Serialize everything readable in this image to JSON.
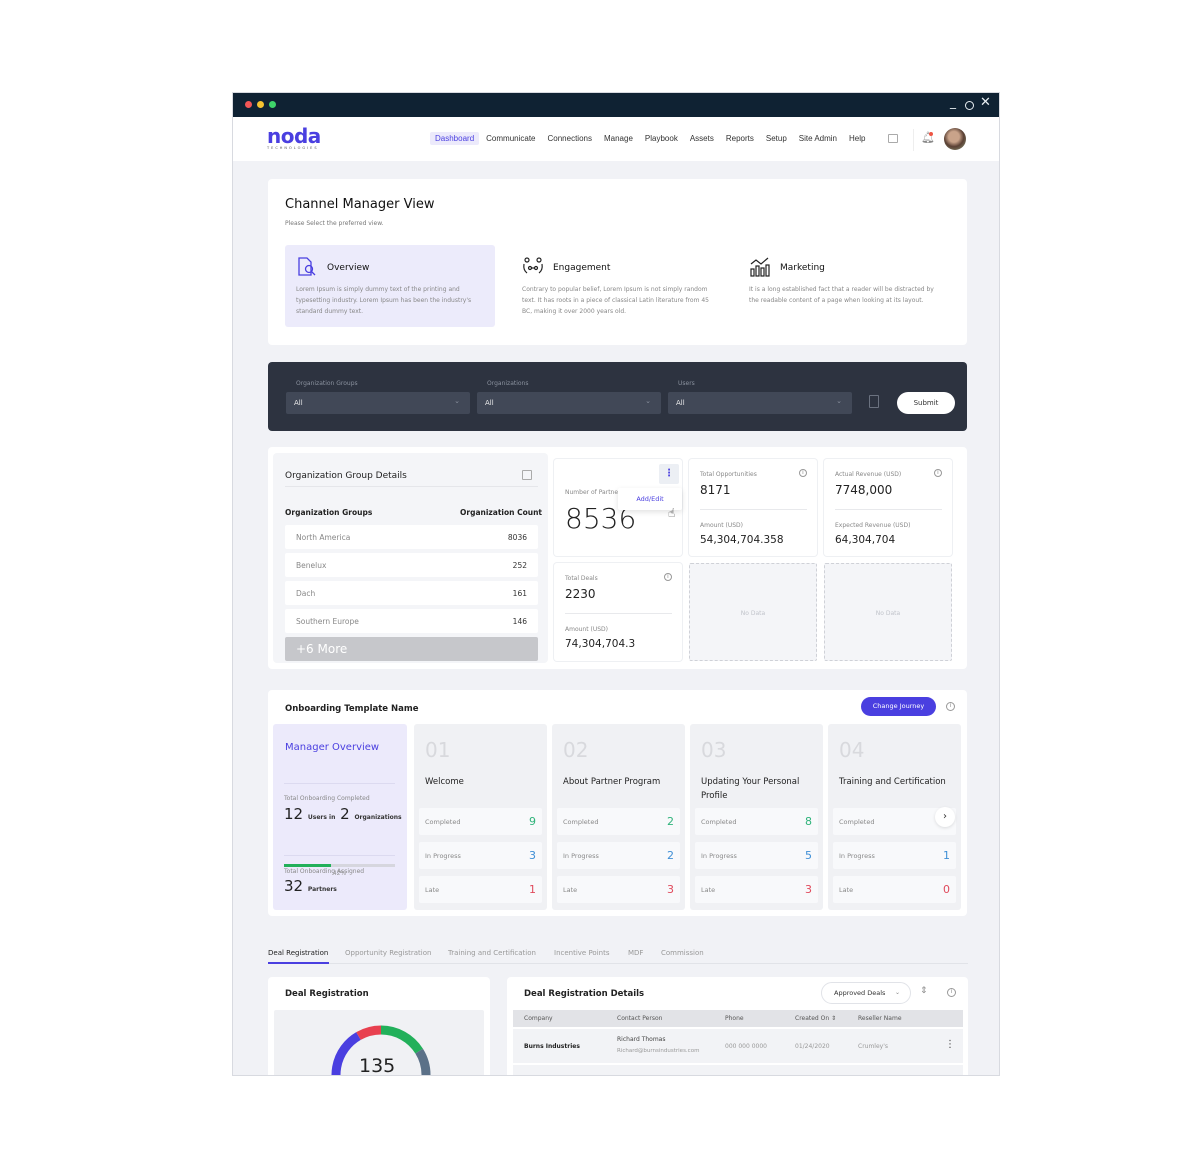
{
  "window": {
    "controls": {
      "minimize": "_",
      "close": "✕"
    }
  },
  "navbar": {
    "logo_text": "noda",
    "logo_subtext": "TECHNOLOGIES",
    "links": [
      "Dashboard",
      "Communicate",
      "Connections",
      "Manage",
      "Playbook",
      "Assets",
      "Reports",
      "Setup",
      "Site Admin",
      "Help"
    ],
    "active_link": "Dashboard",
    "icons": [
      "list-icon",
      "bell-icon",
      "avatar"
    ]
  },
  "channel_manager": {
    "title": "Channel Manager View",
    "subtitle": "Please Select the preferred view.",
    "views": [
      {
        "icon": "document-search-icon",
        "title": "Overview",
        "description": "Lorem Ipsum is simply dummy text of the printing and typesetting industry. Lorem Ipsum has been the industry's standard dummy text.",
        "selected": true
      },
      {
        "icon": "people-connect-icon",
        "title": "Engagement",
        "description": "Contrary to popular belief, Lorem Ipsum is not simply random text. It has roots in a piece of classical Latin literature from 45 BC, making it over 2000 years old.",
        "selected": false
      },
      {
        "icon": "chart-growth-icon",
        "title": "Marketing",
        "description": "It is a long established fact that a reader will be distracted by the readable content of a page when looking at its layout.",
        "selected": false
      }
    ]
  },
  "filters": {
    "fields": [
      {
        "label": "Organization Groups",
        "value": "All"
      },
      {
        "label": "Organizations",
        "value": "All"
      },
      {
        "label": "Users",
        "value": "All"
      }
    ],
    "submit_label": "Submit"
  },
  "org_group_details": {
    "title": "Organization Group Details",
    "col_groups": "Organization Groups",
    "col_count": "Organization Count",
    "rows": [
      {
        "name": "North America",
        "count": "8036"
      },
      {
        "name": "Benelux",
        "count": "252"
      },
      {
        "name": "Dach",
        "count": "161"
      },
      {
        "name": "Southern Europe",
        "count": "146"
      }
    ],
    "more_label": "+6 More"
  },
  "stats": {
    "partners": {
      "label": "Number of Partners",
      "value": "8536",
      "menu_item": "Add/Edit"
    },
    "opportunities": {
      "label": "Total Opportunities",
      "value": "8171",
      "sub_label": "Amount (USD)",
      "sub_value": "54,304,704.358"
    },
    "revenue": {
      "label": "Actual Revenue (USD)",
      "value": "7748,000",
      "sub_label": "Expected Revenue (USD)",
      "sub_value": "64,304,704"
    },
    "deals": {
      "label": "Total Deals",
      "value": "2230",
      "sub_label": "Amount (USD)",
      "sub_value": "74,304,704.3"
    },
    "no_data_label": "No Data"
  },
  "onboarding": {
    "title": "Onboarding Template Name",
    "change_journey_label": "Change Journey",
    "manager": {
      "title": "Manager Overview",
      "completed_label": "Total Onboarding Completed",
      "users": "12",
      "users_text": "Users in",
      "orgs": "2",
      "orgs_text": "Organizations",
      "progress_percent": 42,
      "progress_label": "42%",
      "assigned_label": "Total Onboarding Assigned",
      "assigned": "32",
      "assigned_text": "Partners"
    },
    "steps": [
      {
        "num": "01",
        "title": "Welcome",
        "completed": "9",
        "in_progress": "3",
        "late": "1"
      },
      {
        "num": "02",
        "title": "About Partner Program",
        "completed": "2",
        "in_progress": "2",
        "late": "3"
      },
      {
        "num": "03",
        "title": "Updating Your Personal Profile",
        "completed": "8",
        "in_progress": "5",
        "late": "3"
      },
      {
        "num": "04",
        "title": "Training and Certification",
        "completed": "",
        "in_progress": "1",
        "late": "0"
      }
    ],
    "row_labels": {
      "completed": "Completed",
      "in_progress": "In Progress",
      "late": "Late"
    },
    "colors": {
      "completed": "#2fb37a",
      "in_progress": "#3f8fd6",
      "late": "#e04a5c"
    }
  },
  "tabs": {
    "items": [
      "Deal Registration",
      "Opportunity Registration",
      "Training and Certification",
      "Incentive Points",
      "MDF",
      "Commission"
    ],
    "active": "Deal Registration"
  },
  "deal_registration": {
    "title": "Deal Registration",
    "total": "135",
    "segment_colors": [
      "#4a3fe0",
      "#e8404f",
      "#22b05a",
      "#5b7188"
    ]
  },
  "deal_details": {
    "title": "Deal Registration Details",
    "filter_value": "Approved Deals",
    "columns": [
      "Company",
      "Contact Person",
      "Phone",
      "Created On ⇕",
      "Reseller Name"
    ],
    "rows": [
      {
        "company": "Burns Industries",
        "contact": "Richard Thomas",
        "email": "Richard@burnsindustries.com",
        "phone": "000 000 0000",
        "created": "01/24/2020",
        "reseller": "Crumley's"
      }
    ]
  }
}
